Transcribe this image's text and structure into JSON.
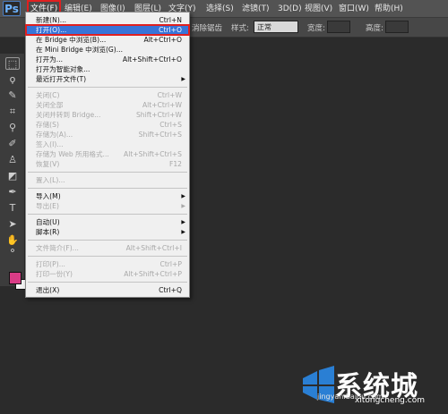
{
  "app": {
    "logo": "Ps"
  },
  "menubar": {
    "items": [
      "文件(F)",
      "编辑(E)",
      "图像(I)",
      "图层(L)",
      "文字(Y)",
      "选择(S)",
      "滤镜(T)",
      "3D(D)",
      "视图(V)",
      "窗口(W)",
      "帮助(H)"
    ]
  },
  "options": {
    "hint": "消除锯齿",
    "style_label": "样式:",
    "style_value": "正常",
    "width_label": "宽度:",
    "height_label": "高度:"
  },
  "file_menu": {
    "items": [
      {
        "label": "新建(N)...",
        "shortcut": "Ctrl+N"
      },
      {
        "label": "打开(O)...",
        "shortcut": "Ctrl+O"
      },
      {
        "label": "在 Bridge 中浏览(B)...",
        "shortcut": "Alt+Ctrl+O"
      },
      {
        "label": "在 Mini Bridge 中浏览(G)...",
        "shortcut": ""
      },
      {
        "label": "打开为...",
        "shortcut": "Alt+Shift+Ctrl+O"
      },
      {
        "label": "打开为智能对象...",
        "shortcut": ""
      },
      {
        "label": "最近打开文件(T)",
        "shortcut": ""
      },
      {
        "label": "关闭(C)",
        "shortcut": "Ctrl+W"
      },
      {
        "label": "关闭全部",
        "shortcut": "Alt+Ctrl+W"
      },
      {
        "label": "关闭并转到 Bridge...",
        "shortcut": "Shift+Ctrl+W"
      },
      {
        "label": "存储(S)",
        "shortcut": "Ctrl+S"
      },
      {
        "label": "存储为(A)...",
        "shortcut": "Shift+Ctrl+S"
      },
      {
        "label": "签入(I)...",
        "shortcut": ""
      },
      {
        "label": "存储为 Web 所用格式...",
        "shortcut": "Alt+Shift+Ctrl+S"
      },
      {
        "label": "恢复(V)",
        "shortcut": "F12"
      },
      {
        "label": "置入(L)...",
        "shortcut": ""
      },
      {
        "label": "导入(M)",
        "shortcut": ""
      },
      {
        "label": "导出(E)",
        "shortcut": ""
      },
      {
        "label": "自动(U)",
        "shortcut": ""
      },
      {
        "label": "脚本(R)",
        "shortcut": ""
      },
      {
        "label": "文件简介(F)...",
        "shortcut": "Alt+Shift+Ctrl+I"
      },
      {
        "label": "打印(P)...",
        "shortcut": "Ctrl+P"
      },
      {
        "label": "打印一份(Y)",
        "shortcut": "Alt+Shift+Ctrl+P"
      },
      {
        "label": "退出(X)",
        "shortcut": "Ctrl+Q"
      }
    ]
  },
  "watermark": {
    "brand": "系统城",
    "domain": "xitongcheng.com",
    "source": "jingyan.baidu.com",
    "color": "#2a7fd4"
  },
  "colors": {
    "foreground": "#d93c86",
    "background": "#f2f2f2",
    "highlight_red": "#e02020"
  }
}
